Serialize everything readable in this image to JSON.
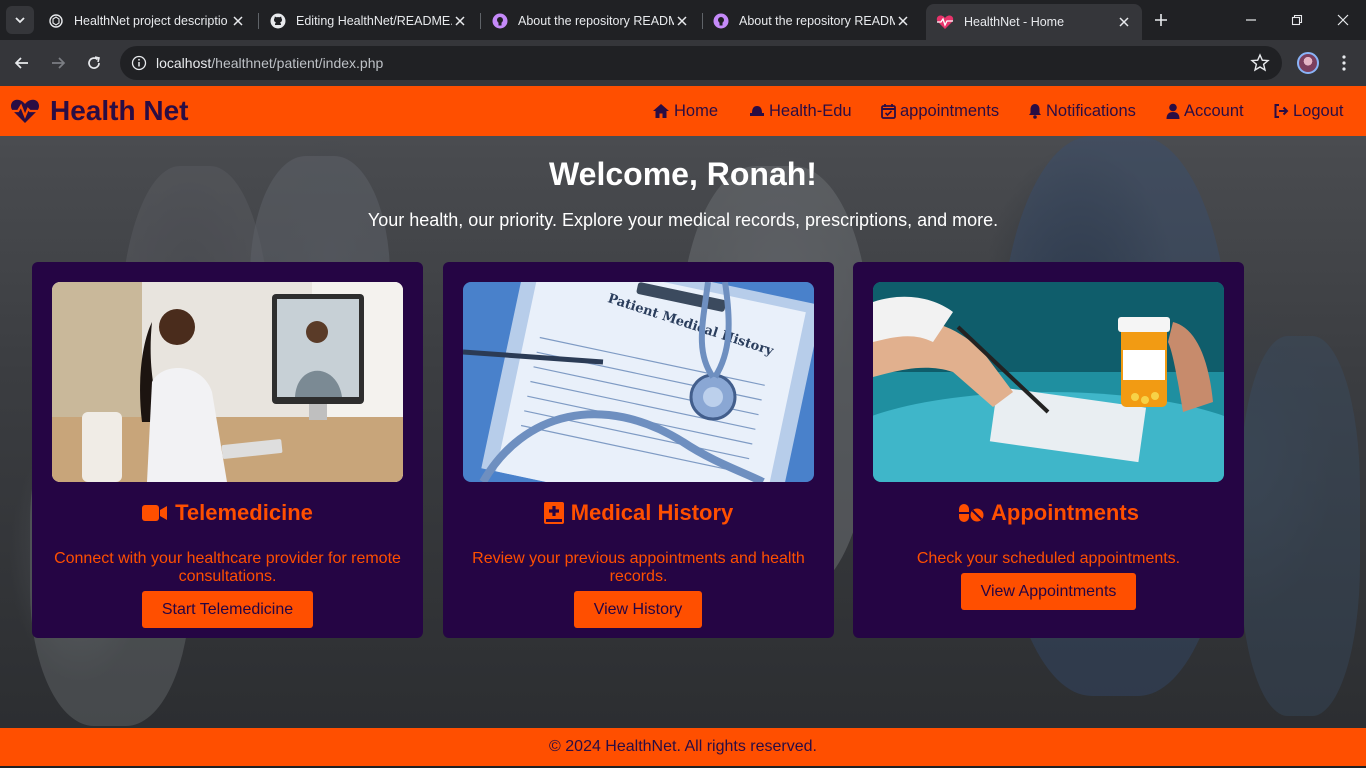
{
  "browser": {
    "tabs": [
      {
        "title": "HealthNet project descriptio",
        "icon": "openai-icon"
      },
      {
        "title": "Editing HealthNet/README.md",
        "icon": "github-icon"
      },
      {
        "title": "About the repository README",
        "icon": "github-icon"
      },
      {
        "title": "About the repository README",
        "icon": "github-icon"
      },
      {
        "title": "HealthNet - Home",
        "icon": "heart-pulse-icon",
        "active": true
      }
    ],
    "url_host": "localhost",
    "url_path": "/healthnet/patient/index.php"
  },
  "navbar": {
    "brand": "Health Net",
    "items": [
      {
        "label": "Home",
        "icon": "home-icon"
      },
      {
        "label": "Health-Edu",
        "icon": "hat-icon"
      },
      {
        "label": "appointments",
        "icon": "calendar-check-icon"
      },
      {
        "label": "Notifications",
        "icon": "bell-icon"
      },
      {
        "label": "Account",
        "icon": "user-icon"
      },
      {
        "label": "Logout",
        "icon": "logout-icon"
      }
    ]
  },
  "hero": {
    "welcome": "Welcome, Ronah!",
    "tagline": "Your health, our priority. Explore your medical records, prescriptions, and more."
  },
  "cards": [
    {
      "title": "Telemedicine",
      "icon": "video-icon",
      "text": "Connect with your healthcare provider for remote consultations.",
      "button": "Start Telemedicine"
    },
    {
      "title": "Medical History",
      "icon": "medical-book-icon",
      "text": "Review your previous appointments and health records.",
      "button": "View History",
      "image_text": "Patient Medical History"
    },
    {
      "title": "Appointments",
      "icon": "pills-icon",
      "text": "Check your scheduled appointments.",
      "button": "View Appointments"
    }
  ],
  "footer": {
    "text": "© 2024 HealthNet. All rights reserved."
  },
  "colors": {
    "accent": "#ff4f00",
    "card_bg": "#250544",
    "text_dark": "#2a0d44"
  }
}
